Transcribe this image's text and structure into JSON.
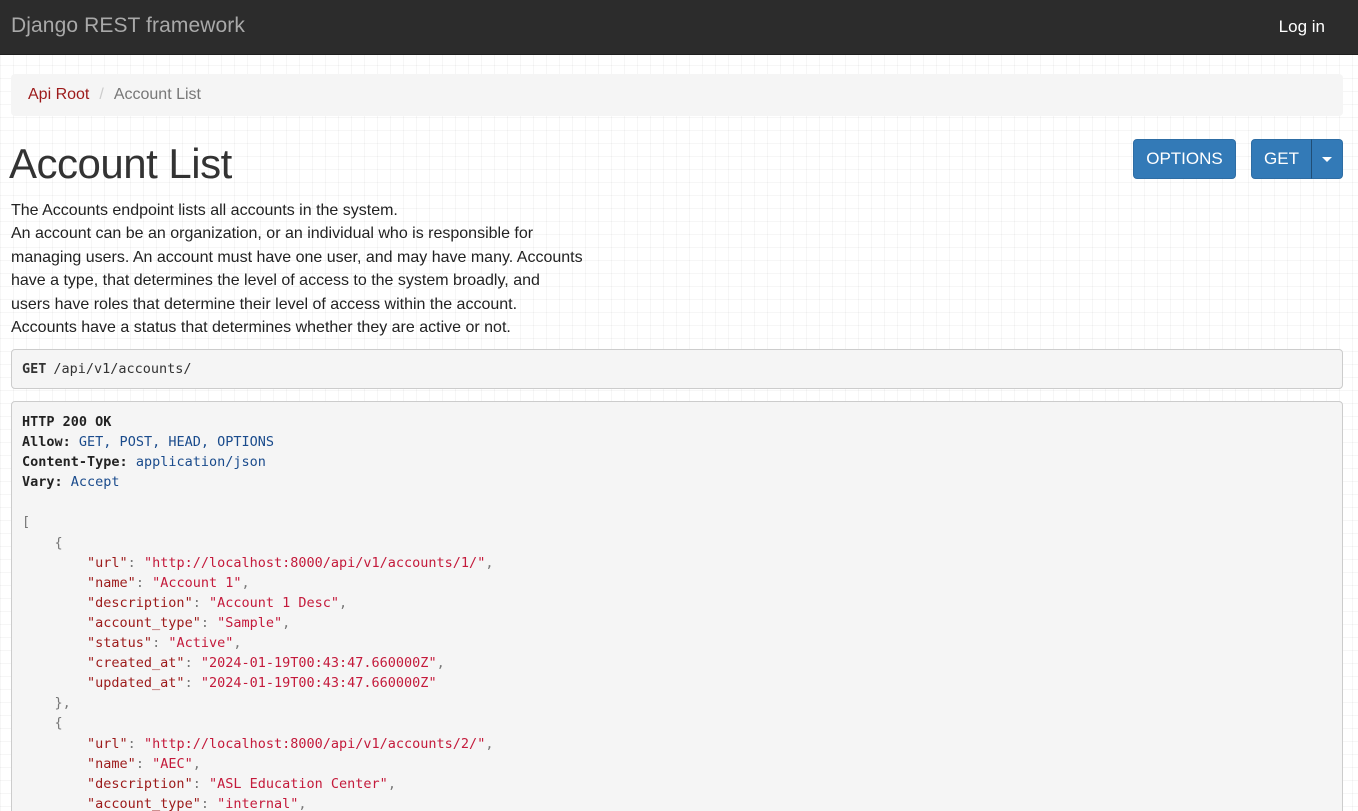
{
  "navbar": {
    "brand": "Django REST framework",
    "login_label": "Log in"
  },
  "breadcrumb": {
    "root_label": "Api Root",
    "separator": "/",
    "current_label": "Account List"
  },
  "page": {
    "title": "Account List",
    "options_button": "OPTIONS",
    "get_button": "GET",
    "description_lines": [
      "The Accounts endpoint lists all accounts in the system.",
      "An account can be an organization, or an individual who is responsible for",
      "managing users. An account must have one user, and may have many. Accounts",
      "have a type, that determines the level of access to the system broadly, and",
      "users have roles that determine their level of access within the account.",
      "Accounts have a status that determines whether they are active or not."
    ]
  },
  "request": {
    "method": "GET",
    "path": "/api/v1/accounts/"
  },
  "response": {
    "status_line": "HTTP 200 OK",
    "headers": [
      {
        "key": "Allow:",
        "value": "GET, POST, HEAD, OPTIONS"
      },
      {
        "key": "Content-Type:",
        "value": "application/json"
      },
      {
        "key": "Vary:",
        "value": "Accept"
      }
    ],
    "accounts": [
      {
        "url": "http://localhost:8000/api/v1/accounts/1/",
        "name": "Account 1",
        "description": "Account 1 Desc",
        "account_type": "Sample",
        "status": "Active",
        "created_at": "2024-01-19T00:43:47.660000Z",
        "updated_at": "2024-01-19T00:43:47.660000Z"
      },
      {
        "url": "http://localhost:8000/api/v1/accounts/2/",
        "name": "AEC",
        "description": "ASL Education Center",
        "account_type": "internal"
      }
    ]
  },
  "colors": {
    "navbar_bg": "#2c2c2c",
    "brand_text": "#a9a9a9",
    "primary_button": "#337ab7",
    "link": "#9c1a1a",
    "json_string": "#c41a3b",
    "header_value": "#1a4b8c"
  },
  "icons": {
    "dropdown": "caret-down-icon"
  }
}
